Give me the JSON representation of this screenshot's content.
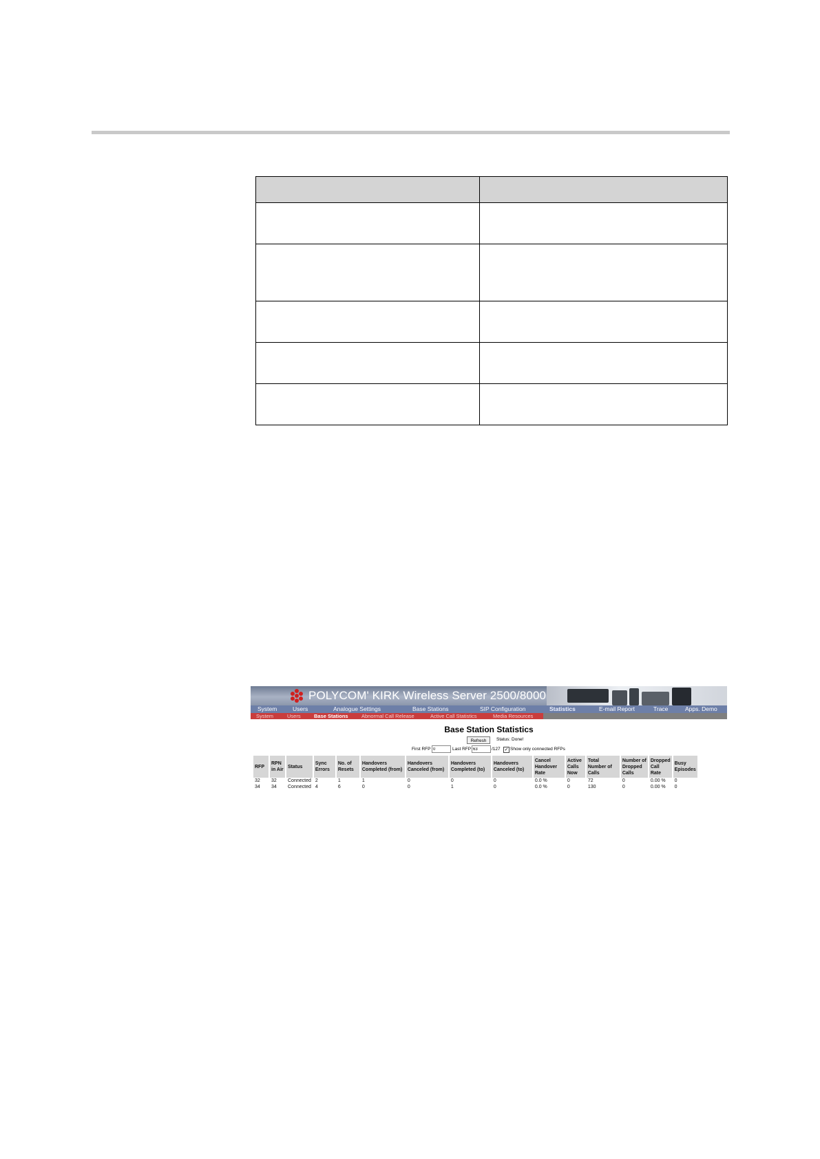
{
  "doc_table": {
    "rows": 6
  },
  "screenshot": {
    "banner_title": "POLYCOM' KIRK Wireless Server 2500/8000",
    "nav_main": [
      "System",
      "Users",
      "Analogue Settings",
      "Base Stations",
      "SIP Configuration",
      "Statistics",
      "E-mail Report",
      "Trace",
      "Apps. Demo"
    ],
    "nav_main_active": "Statistics",
    "nav_sub": [
      "System",
      "Users",
      "Base Stations",
      "Abnormal Call Release",
      "Active Call Statistics",
      "Media Resources"
    ],
    "nav_sub_active": "Base Stations",
    "title": "Base Station Statistics",
    "refresh_label": "Refresh",
    "status_text": "Status: Done!",
    "first_rfp_label": "First RFP",
    "first_rfp_value": "0",
    "last_rfp_label": "Last RFP",
    "last_rfp_value": "63",
    "rfp_total": "/127",
    "show_only_label": "Show only connected RFPs",
    "show_only_checked": true,
    "columns": [
      "RFP",
      "RPN in Air",
      "Status",
      "Sync Errors",
      "No. of Resets",
      "Handovers Completed (from)",
      "Handovers Canceled (from)",
      "Handovers Completed (to)",
      "Handovers Canceled (to)",
      "Cancel Handover Rate",
      "Active Calls Now",
      "Total Number of Calls",
      "Number of Dropped Calls",
      "Dropped Call Rate",
      "Busy Episodes"
    ],
    "rows": [
      [
        "32",
        "32",
        "Connected",
        "2",
        "1",
        "1",
        "0",
        "0",
        "0",
        "0.0 %",
        "0",
        "72",
        "0",
        "0.00 %",
        "0"
      ],
      [
        "34",
        "34",
        "Connected",
        "4",
        "6",
        "0",
        "0",
        "1",
        "0",
        "0.0 %",
        "0",
        "130",
        "0",
        "0.00 %",
        "0"
      ]
    ]
  }
}
